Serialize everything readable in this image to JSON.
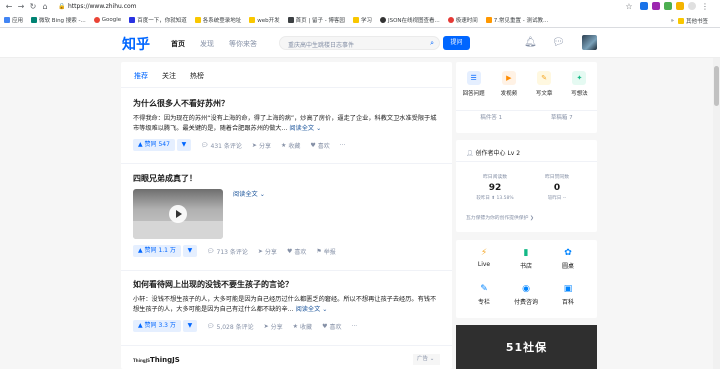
{
  "browser": {
    "url": "https://www.zhihu.com",
    "bookmarks": [
      "应用",
      "微软 Bing 搜索 -...",
      "Google",
      "百度一下，你就知道",
      "各系统登录地址",
      "web开发",
      "首页 | 留子 - 博客园",
      "学习",
      "JSON在线视图查看...",
      "极速时间",
      "7.常见重置 - 测试教...",
      "其他书签"
    ]
  },
  "header": {
    "logo": "知乎",
    "nav": [
      "首页",
      "发现",
      "等你来答"
    ],
    "search_placeholder": "重庆高中生跳楼日志事件",
    "ask_label": "提问"
  },
  "feed": {
    "tabs": [
      "推荐",
      "关注",
      "热榜"
    ],
    "items": [
      {
        "title": "为什么很多人不看好苏州？",
        "excerpt": "不得我命：因为现在的苏州“没有上海的命，得了上海的病”，炒高了房价，逼走了企业，科教文卫水准受限于城市等级难以腾飞。最关键的是，随着合肥跟苏州的做大...",
        "read_more": "阅读全文",
        "vote": "赞同 547",
        "comments": "431 条评论",
        "share": "分享",
        "favorite": "收藏",
        "like": "喜欢",
        "more": "···"
      },
      {
        "title": "四眼兄弟成真了！",
        "read_more": "阅读全文",
        "vote": "赞同 1.1 万",
        "comments": "713 条评论",
        "share": "分享",
        "like": "喜欢",
        "report": "举报"
      },
      {
        "title": "如何看待网上出现的没钱不要生孩子的言论？",
        "excerpt": "小轩：没钱不想生孩子的人，大多可能是因为自己经历过什么都匮乏的窘经。所以不想再让孩子去经历。有钱不想生孩子的人，大多可能是因为自己有过什么都不缺的辛...",
        "read_more": "阅读全文",
        "vote": "赞同 3.3 万",
        "comments": "5,028 条评论",
        "share": "分享",
        "favorite": "收藏",
        "like": "喜欢",
        "more": "···"
      }
    ],
    "ad": {
      "brand_logo": "ThingJS",
      "name": "ThingJS",
      "tag": "广告"
    }
  },
  "sidebar": {
    "actions": [
      "回答问题",
      "发视频",
      "写文章",
      "写想法"
    ],
    "drafts": [
      "稿件答 1",
      "草稿箱 7"
    ],
    "creator": {
      "title": "创作者中心 Lv 2",
      "stat1_label": "昨日阅读数",
      "stat1_value": "92",
      "stat1_sub": "较昨日 ⬆ 13.58%",
      "stat2_label": "昨日赞同数",
      "stat2_value": "0",
      "stat2_sub": "较昨日 --",
      "promo": "瓦力保镖为你的创作提供保护 ❯"
    },
    "services": [
      "Live",
      "书店",
      "圆桌",
      "专栏",
      "付费咨询",
      "百科"
    ],
    "banner": "51社保"
  }
}
